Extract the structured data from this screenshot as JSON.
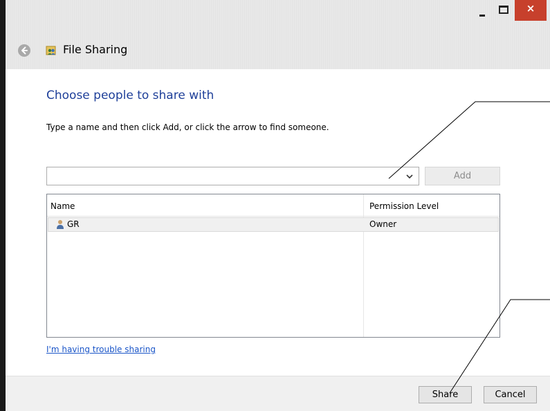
{
  "window": {
    "title": "File Sharing",
    "controls": {
      "minimize": "minimize",
      "maximize": "maximize",
      "close": "×"
    }
  },
  "main": {
    "heading": "Choose people to share with",
    "instructions": "Type a name and then click Add, or click the arrow to find someone.",
    "name_input": {
      "value": "",
      "placeholder": ""
    },
    "add_label": "Add",
    "table": {
      "columns": [
        "Name",
        "Permission Level"
      ],
      "rows": [
        {
          "name": "GR",
          "permission": "Owner"
        }
      ]
    },
    "trouble_link": "I'm having trouble sharing"
  },
  "footer": {
    "share_label": "Share",
    "cancel_label": "Cancel"
  },
  "icons": {
    "back": "back-arrow-icon",
    "app": "file-sharing-icon",
    "user": "user-icon",
    "dropdown": "chevron-down-icon"
  },
  "colors": {
    "heading": "#1e3f99",
    "link": "#1a55c8",
    "close_button": "#c7402c"
  }
}
